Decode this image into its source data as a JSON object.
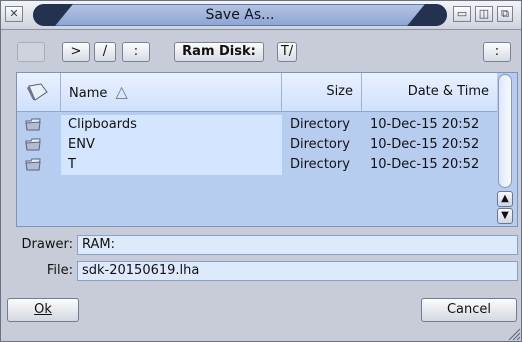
{
  "window": {
    "title": "Save As...",
    "titlebar_buttons": [
      "close-icon",
      "iconify-icon",
      "depth-icon",
      "zoom-icon"
    ]
  },
  "toolbar": {
    "parent_label": "",
    "forward_label": ">",
    "root_label": "/",
    "device_label": ":",
    "volume_label": "Ram Disk:",
    "path_label": "T/",
    "menu_label": ":"
  },
  "list": {
    "columns": {
      "icon": "",
      "name": "Name",
      "size": "Size",
      "date": "Date & Time"
    },
    "sort_indicator": "△",
    "rows": [
      {
        "name": "Clipboards",
        "size": "Directory",
        "date": "10-Dec-15 20:52",
        "icon": "folder-icon"
      },
      {
        "name": "ENV",
        "size": "Directory",
        "date": "10-Dec-15 20:52",
        "icon": "folder-icon"
      },
      {
        "name": "T",
        "size": "Directory",
        "date": "10-Dec-15 20:52",
        "icon": "folder-icon"
      }
    ]
  },
  "fields": {
    "drawer_label": "Drawer:",
    "drawer_value": "RAM:",
    "file_label": "File:",
    "file_value": "sdk-20150619.lha"
  },
  "buttons": {
    "ok_label": "Ok",
    "cancel_label": "Cancel"
  },
  "colors": {
    "list_bg": "#b7cdf0",
    "selection": "#d4e6ff",
    "title_pill": "#8ea6d3"
  }
}
